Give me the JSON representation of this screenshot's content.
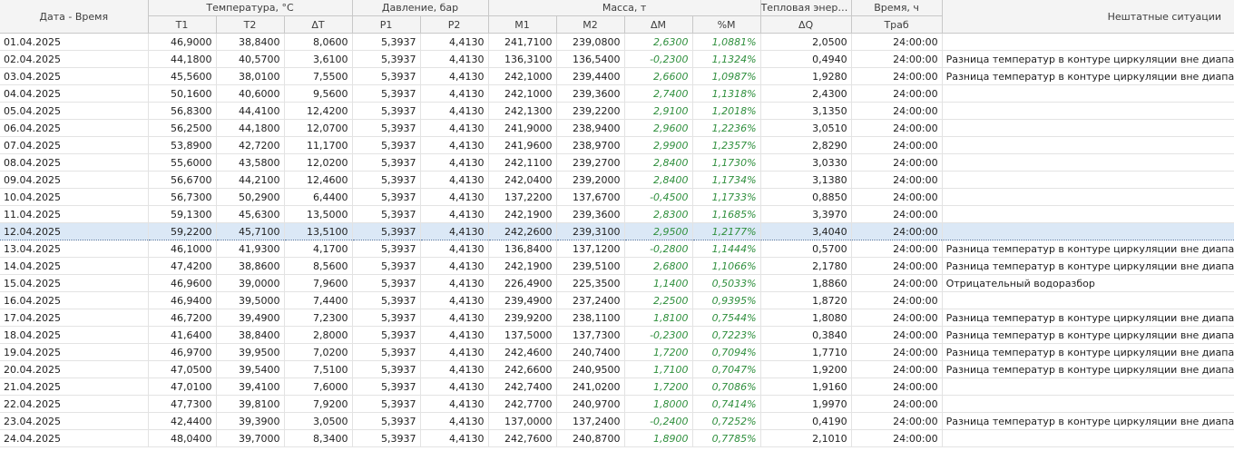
{
  "headers": {
    "date": "Дата - Время",
    "groups": [
      {
        "label": "Температура, °C",
        "cols": [
          "T1",
          "T2",
          "ΔT"
        ]
      },
      {
        "label": "Давление, бар",
        "cols": [
          "P1",
          "P2"
        ]
      },
      {
        "label": "Масса, т",
        "cols": [
          "M1",
          "M2",
          "ΔM",
          "%M"
        ]
      },
      {
        "label": "Тепловая энерг…",
        "cols": [
          "ΔQ"
        ]
      },
      {
        "label": "Время, ч",
        "cols": [
          "Траб"
        ]
      }
    ],
    "notes": "Нештатные ситуации"
  },
  "selected_index": 11,
  "rows": [
    {
      "date": "01.04.2025",
      "t1": "46,9000",
      "t2": "38,8400",
      "dt": "8,0600",
      "p1": "5,3937",
      "p2": "4,4130",
      "m1": "241,7100",
      "m2": "239,0800",
      "dm": "2,6300",
      "pm": "1,0881%",
      "dq": "2,0500",
      "time": "24:00:00",
      "note": ""
    },
    {
      "date": "02.04.2025",
      "t1": "44,1800",
      "t2": "40,5700",
      "dt": "3,6100",
      "p1": "5,3937",
      "p2": "4,4130",
      "m1": "136,3100",
      "m2": "136,5400",
      "dm": "-0,2300",
      "pm": "1,1324%",
      "dq": "0,4940",
      "time": "24:00:00",
      "note": "Разница температур в контуре циркуляции вне диапазона"
    },
    {
      "date": "03.04.2025",
      "t1": "45,5600",
      "t2": "38,0100",
      "dt": "7,5500",
      "p1": "5,3937",
      "p2": "4,4130",
      "m1": "242,1000",
      "m2": "239,4400",
      "dm": "2,6600",
      "pm": "1,0987%",
      "dq": "1,9280",
      "time": "24:00:00",
      "note": "Разница температур в контуре циркуляции вне диапазона"
    },
    {
      "date": "04.04.2025",
      "t1": "50,1600",
      "t2": "40,6000",
      "dt": "9,5600",
      "p1": "5,3937",
      "p2": "4,4130",
      "m1": "242,1000",
      "m2": "239,3600",
      "dm": "2,7400",
      "pm": "1,1318%",
      "dq": "2,4300",
      "time": "24:00:00",
      "note": ""
    },
    {
      "date": "05.04.2025",
      "t1": "56,8300",
      "t2": "44,4100",
      "dt": "12,4200",
      "p1": "5,3937",
      "p2": "4,4130",
      "m1": "242,1300",
      "m2": "239,2200",
      "dm": "2,9100",
      "pm": "1,2018%",
      "dq": "3,1350",
      "time": "24:00:00",
      "note": ""
    },
    {
      "date": "06.04.2025",
      "t1": "56,2500",
      "t2": "44,1800",
      "dt": "12,0700",
      "p1": "5,3937",
      "p2": "4,4130",
      "m1": "241,9000",
      "m2": "238,9400",
      "dm": "2,9600",
      "pm": "1,2236%",
      "dq": "3,0510",
      "time": "24:00:00",
      "note": ""
    },
    {
      "date": "07.04.2025",
      "t1": "53,8900",
      "t2": "42,7200",
      "dt": "11,1700",
      "p1": "5,3937",
      "p2": "4,4130",
      "m1": "241,9600",
      "m2": "238,9700",
      "dm": "2,9900",
      "pm": "1,2357%",
      "dq": "2,8290",
      "time": "24:00:00",
      "note": ""
    },
    {
      "date": "08.04.2025",
      "t1": "55,6000",
      "t2": "43,5800",
      "dt": "12,0200",
      "p1": "5,3937",
      "p2": "4,4130",
      "m1": "242,1100",
      "m2": "239,2700",
      "dm": "2,8400",
      "pm": "1,1730%",
      "dq": "3,0330",
      "time": "24:00:00",
      "note": ""
    },
    {
      "date": "09.04.2025",
      "t1": "56,6700",
      "t2": "44,2100",
      "dt": "12,4600",
      "p1": "5,3937",
      "p2": "4,4130",
      "m1": "242,0400",
      "m2": "239,2000",
      "dm": "2,8400",
      "pm": "1,1734%",
      "dq": "3,1380",
      "time": "24:00:00",
      "note": ""
    },
    {
      "date": "10.04.2025",
      "t1": "56,7300",
      "t2": "50,2900",
      "dt": "6,4400",
      "p1": "5,3937",
      "p2": "4,4130",
      "m1": "137,2200",
      "m2": "137,6700",
      "dm": "-0,4500",
      "pm": "1,1733%",
      "dq": "0,8850",
      "time": "24:00:00",
      "note": ""
    },
    {
      "date": "11.04.2025",
      "t1": "59,1300",
      "t2": "45,6300",
      "dt": "13,5000",
      "p1": "5,3937",
      "p2": "4,4130",
      "m1": "242,1900",
      "m2": "239,3600",
      "dm": "2,8300",
      "pm": "1,1685%",
      "dq": "3,3970",
      "time": "24:00:00",
      "note": ""
    },
    {
      "date": "12.04.2025",
      "t1": "59,2200",
      "t2": "45,7100",
      "dt": "13,5100",
      "p1": "5,3937",
      "p2": "4,4130",
      "m1": "242,2600",
      "m2": "239,3100",
      "dm": "2,9500",
      "pm": "1,2177%",
      "dq": "3,4040",
      "time": "24:00:00",
      "note": ""
    },
    {
      "date": "13.04.2025",
      "t1": "46,1000",
      "t2": "41,9300",
      "dt": "4,1700",
      "p1": "5,3937",
      "p2": "4,4130",
      "m1": "136,8400",
      "m2": "137,1200",
      "dm": "-0,2800",
      "pm": "1,1444%",
      "dq": "0,5700",
      "time": "24:00:00",
      "note": "Разница температур в контуре циркуляции вне диапазона"
    },
    {
      "date": "14.04.2025",
      "t1": "47,4200",
      "t2": "38,8600",
      "dt": "8,5600",
      "p1": "5,3937",
      "p2": "4,4130",
      "m1": "242,1900",
      "m2": "239,5100",
      "dm": "2,6800",
      "pm": "1,1066%",
      "dq": "2,1780",
      "time": "24:00:00",
      "note": "Разница температур в контуре циркуляции вне диапазона"
    },
    {
      "date": "15.04.2025",
      "t1": "46,9600",
      "t2": "39,0000",
      "dt": "7,9600",
      "p1": "5,3937",
      "p2": "4,4130",
      "m1": "226,4900",
      "m2": "225,3500",
      "dm": "1,1400",
      "pm": "0,5033%",
      "dq": "1,8860",
      "time": "24:00:00",
      "note": "Отрицательный водоразбор"
    },
    {
      "date": "16.04.2025",
      "t1": "46,9400",
      "t2": "39,5000",
      "dt": "7,4400",
      "p1": "5,3937",
      "p2": "4,4130",
      "m1": "239,4900",
      "m2": "237,2400",
      "dm": "2,2500",
      "pm": "0,9395%",
      "dq": "1,8720",
      "time": "24:00:00",
      "note": ""
    },
    {
      "date": "17.04.2025",
      "t1": "46,7200",
      "t2": "39,4900",
      "dt": "7,2300",
      "p1": "5,3937",
      "p2": "4,4130",
      "m1": "239,9200",
      "m2": "238,1100",
      "dm": "1,8100",
      "pm": "0,7544%",
      "dq": "1,8080",
      "time": "24:00:00",
      "note": "Разница температур в контуре циркуляции вне диапазона"
    },
    {
      "date": "18.04.2025",
      "t1": "41,6400",
      "t2": "38,8400",
      "dt": "2,8000",
      "p1": "5,3937",
      "p2": "4,4130",
      "m1": "137,5000",
      "m2": "137,7300",
      "dm": "-0,2300",
      "pm": "0,7223%",
      "dq": "0,3840",
      "time": "24:00:00",
      "note": "Разница температур в контуре циркуляции вне диапазона"
    },
    {
      "date": "19.04.2025",
      "t1": "46,9700",
      "t2": "39,9500",
      "dt": "7,0200",
      "p1": "5,3937",
      "p2": "4,4130",
      "m1": "242,4600",
      "m2": "240,7400",
      "dm": "1,7200",
      "pm": "0,7094%",
      "dq": "1,7710",
      "time": "24:00:00",
      "note": "Разница температур в контуре циркуляции вне диапазона"
    },
    {
      "date": "20.04.2025",
      "t1": "47,0500",
      "t2": "39,5400",
      "dt": "7,5100",
      "p1": "5,3937",
      "p2": "4,4130",
      "m1": "242,6600",
      "m2": "240,9500",
      "dm": "1,7100",
      "pm": "0,7047%",
      "dq": "1,9200",
      "time": "24:00:00",
      "note": "Разница температур в контуре циркуляции вне диапазона"
    },
    {
      "date": "21.04.2025",
      "t1": "47,0100",
      "t2": "39,4100",
      "dt": "7,6000",
      "p1": "5,3937",
      "p2": "4,4130",
      "m1": "242,7400",
      "m2": "241,0200",
      "dm": "1,7200",
      "pm": "0,7086%",
      "dq": "1,9160",
      "time": "24:00:00",
      "note": ""
    },
    {
      "date": "22.04.2025",
      "t1": "47,7300",
      "t2": "39,8100",
      "dt": "7,9200",
      "p1": "5,3937",
      "p2": "4,4130",
      "m1": "242,7700",
      "m2": "240,9700",
      "dm": "1,8000",
      "pm": "0,7414%",
      "dq": "1,9970",
      "time": "24:00:00",
      "note": ""
    },
    {
      "date": "23.04.2025",
      "t1": "42,4400",
      "t2": "39,3900",
      "dt": "3,0500",
      "p1": "5,3937",
      "p2": "4,4130",
      "m1": "137,0000",
      "m2": "137,2400",
      "dm": "-0,2400",
      "pm": "0,7252%",
      "dq": "0,4190",
      "time": "24:00:00",
      "note": "Разница температур в контуре циркуляции вне диапазона"
    },
    {
      "date": "24.04.2025",
      "t1": "48,0400",
      "t2": "39,7000",
      "dt": "8,3400",
      "p1": "5,3937",
      "p2": "4,4130",
      "m1": "242,7600",
      "m2": "240,8700",
      "dm": "1,8900",
      "pm": "0,7785%",
      "dq": "2,1010",
      "time": "24:00:00",
      "note": ""
    }
  ]
}
